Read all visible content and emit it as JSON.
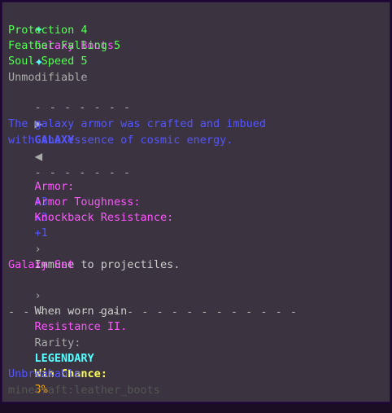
{
  "item": {
    "star_left": "✦",
    "name": "Galaxy Boots",
    "star_right": "✦",
    "enchantments": [
      "Protection 4",
      "Feather Falling 5",
      "Soul Speed 5"
    ],
    "unmodifiable": "Unmodifiable",
    "divider_left": "- - - - - - -",
    "arrow_right": "▶",
    "set_name": "GALAXY",
    "arrow_left": "◀",
    "divider_right": "- - - - - - -",
    "description": [
      "The galaxy armor was crafted and imbued",
      "with the essence of cosmic energy."
    ],
    "stats": [
      {
        "label": "Armor:",
        "value": "+3"
      },
      {
        "label": "Armor Toughness:",
        "value": "+3"
      },
      {
        "label": "Knockback Resistance:",
        "value": "+1"
      }
    ],
    "ability_marker": "›",
    "ability": "Immune to projectiles.",
    "set_bonus_title": "Galaxy Set",
    "set_bonus_prefix": "When worn gain",
    "set_bonus_effect": "Resistance II.",
    "bottom_divider": "- - - - - - - - - - - - - - - - - - - -",
    "rarity_label": "Rarity:",
    "rarity_value": "LEGENDARY",
    "win_chance_label": "Win Chance:",
    "win_chance_value": "3%",
    "unbreakable": "Unbreakable",
    "item_id": "minecraft:leather_boots"
  },
  "colors": {
    "background": "#3b3440",
    "border": "#1c0830",
    "name": "#ff55ff",
    "star": "#55ffff",
    "enchant": "#55ff55",
    "description": "#5555ff",
    "rarity": "#55ffff",
    "win_chance": "#ffff55",
    "win_value": "#ffaa00"
  }
}
